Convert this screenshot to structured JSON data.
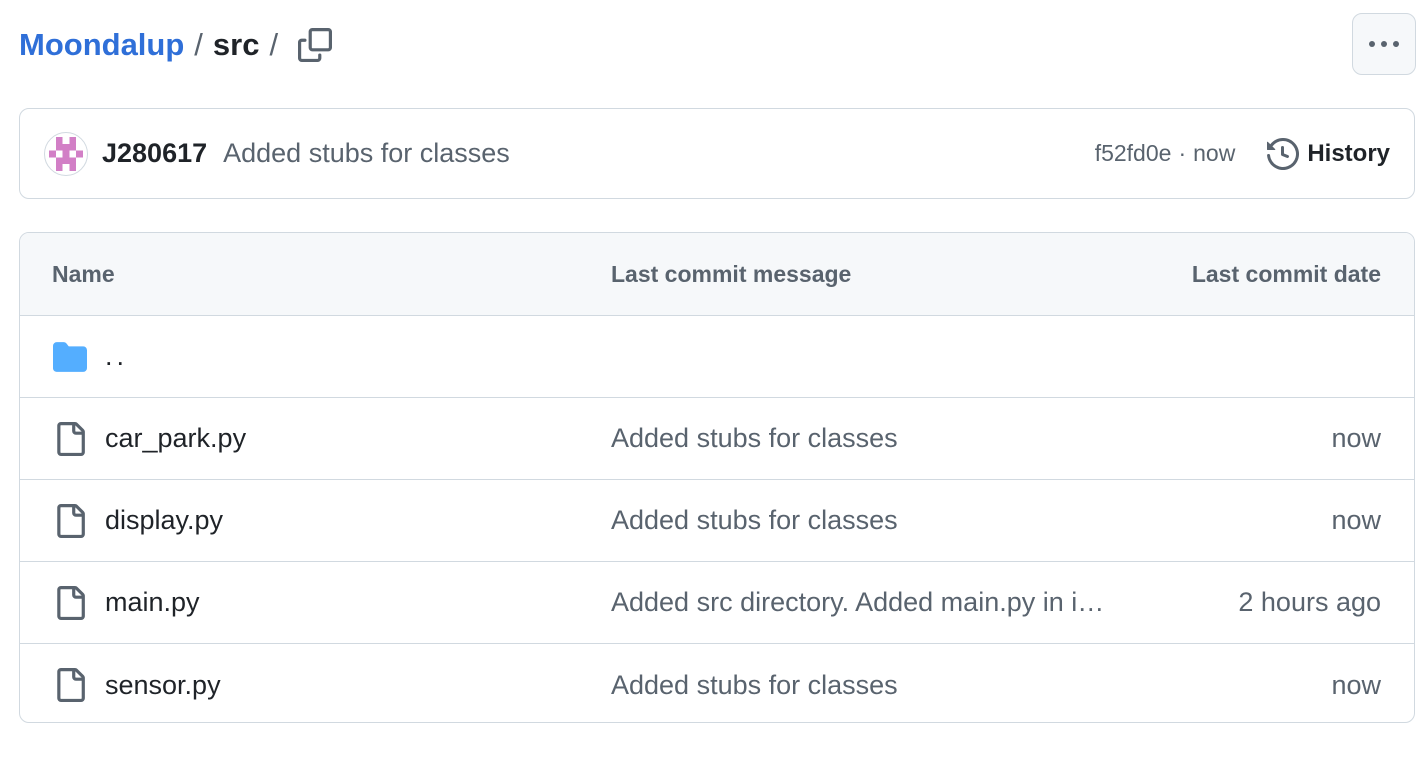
{
  "breadcrumb": {
    "repo": "Moondalup",
    "separator": "/",
    "directory": "src",
    "trailing_separator": "/"
  },
  "latest_commit": {
    "author": "J280617",
    "message": "Added stubs for classes",
    "sha": "f52fd0e",
    "dot": "·",
    "time": "now",
    "history_label": "History"
  },
  "table": {
    "headers": {
      "name": "Name",
      "message": "Last commit message",
      "date": "Last commit date"
    },
    "parent_dir": "..",
    "files": [
      {
        "name": "car_park.py",
        "message": "Added stubs for classes",
        "date": "now"
      },
      {
        "name": "display.py",
        "message": "Added stubs for classes",
        "date": "now"
      },
      {
        "name": "main.py",
        "message": "Added src directory. Added main.py in i…",
        "date": "2 hours ago"
      },
      {
        "name": "sensor.py",
        "message": "Added stubs for classes",
        "date": "now"
      }
    ]
  },
  "icons": {
    "copy": "copy-icon",
    "more": "kebab-horizontal-icon",
    "history": "history-icon",
    "folder": "folder-icon",
    "file": "file-icon"
  },
  "colors": {
    "link": "#2f6fd8",
    "folder": "#54aeff",
    "muted": "#59636e",
    "border": "#d1d9e0",
    "header_bg": "#f6f8fa",
    "avatar": "#d27fc6"
  }
}
